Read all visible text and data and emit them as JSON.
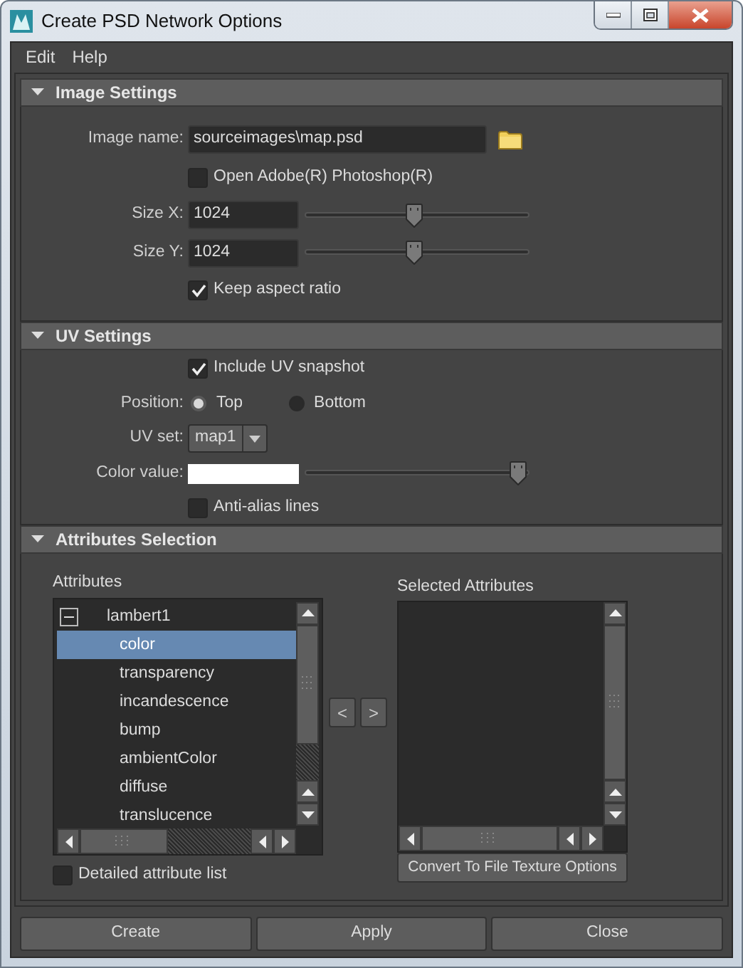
{
  "window": {
    "title": "Create PSD Network Options"
  },
  "menu": [
    {
      "label": "Edit"
    },
    {
      "label": "Help"
    }
  ],
  "sections": [
    {
      "title": "Image Settings",
      "expanded": true,
      "rows": [
        {
          "kind": "file",
          "label": "Image name:",
          "value": "sourceimages\\map.psd"
        },
        {
          "kind": "checkbox",
          "label": "Open Adobe(R) Photoshop(R)",
          "checked": false
        },
        {
          "kind": "slider",
          "label": "Size X:",
          "value": "1024",
          "level": 0.49
        },
        {
          "kind": "slider",
          "label": "Size Y:",
          "value": "1024",
          "level": 0.49
        },
        {
          "kind": "checkbox",
          "label": "Keep aspect ratio",
          "checked": true
        }
      ]
    },
    {
      "title": "UV Settings",
      "expanded": true,
      "rows": [
        {
          "kind": "checkbox",
          "label": "Include UV snapshot",
          "checked": true
        },
        {
          "kind": "radio",
          "label": "Position:",
          "options": [
            {
              "label": "Top",
              "selected": true
            },
            {
              "label": "Bottom",
              "selected": false
            }
          ]
        },
        {
          "kind": "dropdown",
          "label": "UV set:",
          "value": "map1"
        },
        {
          "kind": "color",
          "label": "Color value:",
          "color": "#ffffff",
          "level": 0.97
        },
        {
          "kind": "checkbox",
          "label": "Anti-alias lines",
          "checked": false
        }
      ]
    },
    {
      "title": "Attributes Selection",
      "expanded": true,
      "attributes": {
        "available_label": "Attributes",
        "tree": [
          {
            "label": "lambert1",
            "expanded": true,
            "children": [
              {
                "label": "color",
                "selected": true
              },
              {
                "label": "transparency",
                "selected": false
              },
              {
                "label": "incandescence",
                "selected": false
              },
              {
                "label": "bump",
                "selected": false
              },
              {
                "label": "ambientColor",
                "selected": false
              },
              {
                "label": "diffuse",
                "selected": false
              },
              {
                "label": "translucence",
                "selected": false
              }
            ]
          }
        ],
        "move_buttons": [
          {
            "label": "<"
          },
          {
            "label": ">"
          }
        ],
        "selected_label": "Selected Attributes",
        "convert_button": "Convert To File Texture Options",
        "detailed": {
          "label": "Detailed attribute list",
          "checked": false
        }
      }
    }
  ],
  "buttons": [
    {
      "label": "Create"
    },
    {
      "label": "Apply"
    },
    {
      "label": "Close"
    }
  ]
}
